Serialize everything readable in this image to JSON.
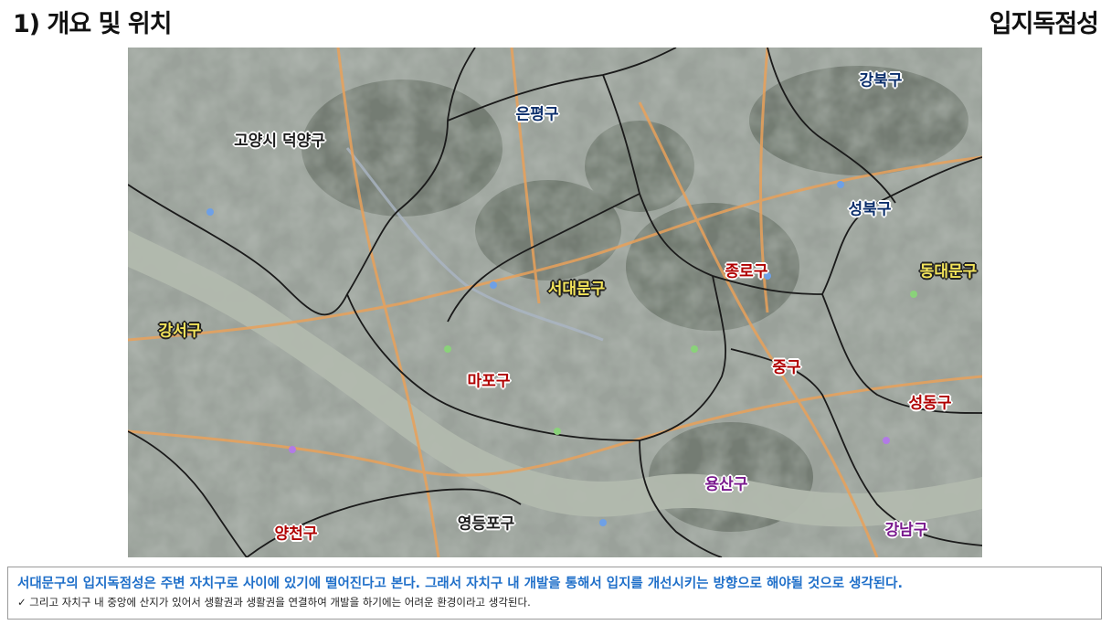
{
  "header": {
    "title_left": "1) 개요 및 위치",
    "title_right": "입지독점성"
  },
  "map": {
    "districts": [
      {
        "id": "gangbuk",
        "name": "강북구",
        "color": "navy"
      },
      {
        "id": "eunpyeong",
        "name": "은평구",
        "color": "navy"
      },
      {
        "id": "goyang",
        "name": "고양시 덕양구",
        "color": "dark"
      },
      {
        "id": "seongbuk",
        "name": "성북구",
        "color": "navy"
      },
      {
        "id": "jongno",
        "name": "종로구",
        "color": "red"
      },
      {
        "id": "dongdaemun",
        "name": "동대문구",
        "color": "yellow"
      },
      {
        "id": "seodaemun",
        "name": "서대문구",
        "color": "yellow"
      },
      {
        "id": "gangseo",
        "name": "강서구",
        "color": "yellow"
      },
      {
        "id": "mapo",
        "name": "마포구",
        "color": "red"
      },
      {
        "id": "junggu",
        "name": "중구",
        "color": "red"
      },
      {
        "id": "seongdong",
        "name": "성동구",
        "color": "red"
      },
      {
        "id": "yongsan",
        "name": "용산구",
        "color": "purple"
      },
      {
        "id": "yeongdeungpo",
        "name": "영등포구",
        "color": "dark"
      },
      {
        "id": "yangcheon",
        "name": "양천구",
        "color": "red"
      },
      {
        "id": "gangnam",
        "name": "강남구",
        "color": "purple"
      }
    ]
  },
  "note": {
    "main": "서대문구의 입지독점성은 주변 자치구로 사이에 있기에 떨어진다고 본다. 그래서 자치구 내 개발을 통해서 입지를 개선시키는 방향으로 해야될 것으로 생각된다.",
    "check": "✓",
    "sub": "그리고 자치구 내 중앙에 산지가 있어서 생활권과 생활권을 연결하여 개발을 하기에는 어려운 환경이라고 생각된다."
  }
}
